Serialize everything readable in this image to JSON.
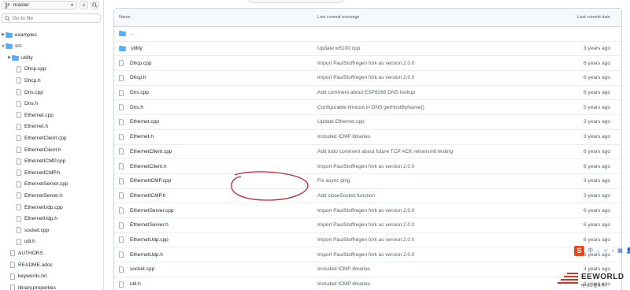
{
  "sidebar": {
    "branch": "master",
    "goto_placeholder": "Go to file",
    "tree": [
      {
        "label": "examples",
        "type": "folder",
        "expanded": false
      },
      {
        "label": "src",
        "type": "folder",
        "expanded": true
      },
      {
        "label": "utility",
        "type": "folder",
        "expanded": false
      },
      {
        "label": "Dhcp.cpp",
        "type": "file"
      },
      {
        "label": "Dhcp.h",
        "type": "file"
      },
      {
        "label": "Dns.cpp",
        "type": "file"
      },
      {
        "label": "Dns.h",
        "type": "file"
      },
      {
        "label": "Ethernet.cpp",
        "type": "file"
      },
      {
        "label": "Ethernet.h",
        "type": "file"
      },
      {
        "label": "EthernetClient.cpp",
        "type": "file"
      },
      {
        "label": "EthernetClient.h",
        "type": "file"
      },
      {
        "label": "EthernetICMP.cpp",
        "type": "file"
      },
      {
        "label": "EthernetICMP.h",
        "type": "file"
      },
      {
        "label": "EthernetServer.cpp",
        "type": "file"
      },
      {
        "label": "EthernetServer.h",
        "type": "file"
      },
      {
        "label": "EthernetUdp.cpp",
        "type": "file"
      },
      {
        "label": "EthernetUdp.h",
        "type": "file"
      },
      {
        "label": "socket.cpp",
        "type": "file"
      },
      {
        "label": "util.h",
        "type": "file"
      },
      {
        "label": "AUTHORS",
        "type": "file"
      },
      {
        "label": "README.adoc",
        "type": "file"
      },
      {
        "label": "keywords.txt",
        "type": "file"
      },
      {
        "label": "library.properties",
        "type": "file"
      }
    ]
  },
  "table": {
    "headers": {
      "name": "Name",
      "message": "Last commit message",
      "date": "Last commit date"
    },
    "parent_dir": "..",
    "rows": [
      {
        "name": "utility",
        "type": "folder",
        "message": "Update w5100.cpp",
        "date": "3 years ago"
      },
      {
        "name": "Dhcp.cpp",
        "type": "file",
        "message": "Import PaulStoffregen fork as version 2.0.0",
        "date": "6 years ago"
      },
      {
        "name": "Dhcp.h",
        "type": "file",
        "message": "Import PaulStoffregen fork as version 2.0.0",
        "date": "6 years ago"
      },
      {
        "name": "Dns.cpp",
        "type": "file",
        "message": "Add comment about ESP8266 DNS lookup",
        "date": "6 years ago"
      },
      {
        "name": "Dns.h",
        "type": "file",
        "message": "Configurable timeout in DNS getHostByName()",
        "date": "5 years ago"
      },
      {
        "name": "Ethernet.cpp",
        "type": "file",
        "message": "Update Ethernet.cpp",
        "date": "3 years ago"
      },
      {
        "name": "Ethernet.h",
        "type": "file",
        "message": "Included ICMP libraries",
        "date": "3 years ago"
      },
      {
        "name": "EthernetClient.cpp",
        "type": "file",
        "message": "Add todo comment about future TCP ACK retransmit testing",
        "date": "6 years ago"
      },
      {
        "name": "EthernetClient.h",
        "type": "file",
        "message": "Import PaulStoffregen fork as version 2.0.0",
        "date": "6 years ago"
      },
      {
        "name": "EthernetICMP.cpp",
        "type": "file",
        "message": "Fix async ping",
        "date": "3 years ago"
      },
      {
        "name": "EthernetICMP.h",
        "type": "file",
        "message": "Add closeSocket function",
        "date": "3 years ago"
      },
      {
        "name": "EthernetServer.cpp",
        "type": "file",
        "message": "Import PaulStoffregen fork as version 2.0.0",
        "date": "6 years ago"
      },
      {
        "name": "EthernetServer.h",
        "type": "file",
        "message": "Import PaulStoffregen fork as version 2.0.0",
        "date": "6 years ago"
      },
      {
        "name": "EthernetUdp.cpp",
        "type": "file",
        "message": "Import PaulStoffregen fork as version 2.0.0",
        "date": "6 years ago"
      },
      {
        "name": "EthernetUdp.h",
        "type": "file",
        "message": "Import PaulStoffregen fork as version 2.0.0",
        "date": "6 years ago"
      },
      {
        "name": "socket.cpp",
        "type": "file",
        "message": "Included ICMP libraries",
        "date": "3 years ago"
      },
      {
        "name": "util.h",
        "type": "file",
        "message": "Included ICMP libraries",
        "date": "3 years ago"
      }
    ]
  },
  "overlay": {
    "ime_letter": "S",
    "watermark_title": "EEWORLD",
    "watermark_sub": "电子工程世界"
  },
  "colors": {
    "folder": "#54aeff",
    "accent": "#0969da",
    "annotation": "#b3282d"
  }
}
